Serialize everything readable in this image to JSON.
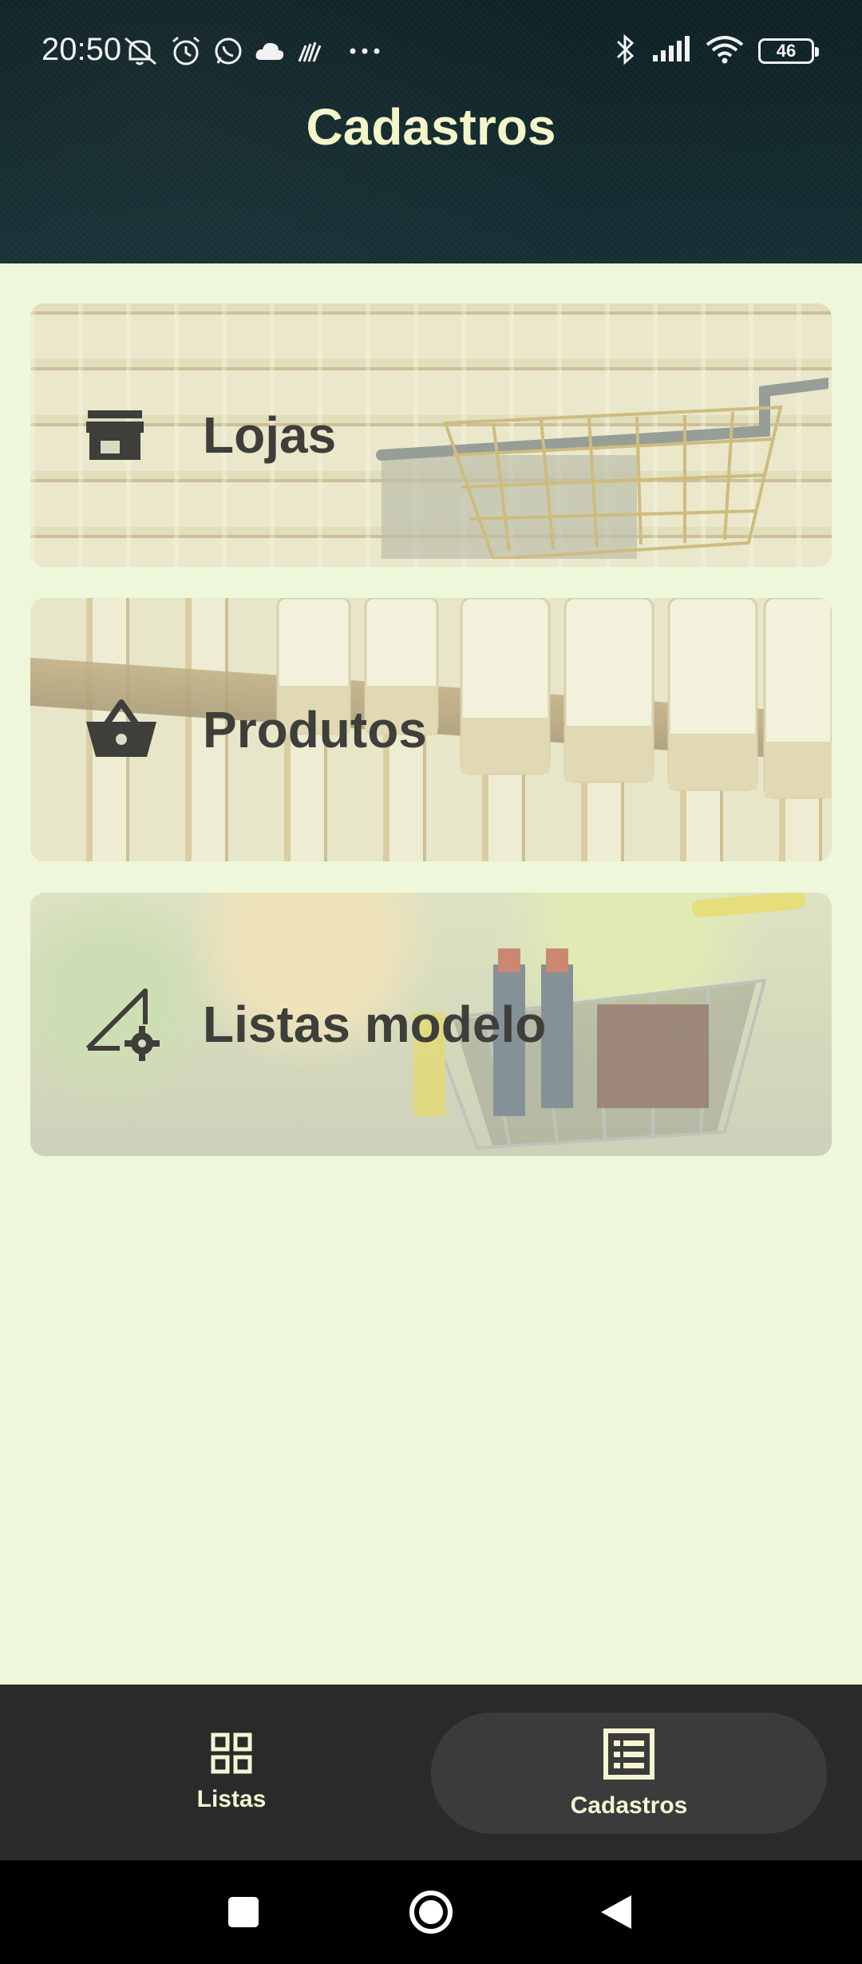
{
  "status_bar": {
    "time": "20:50",
    "battery": "46",
    "left_icons": [
      "mute-icon",
      "alarm-icon",
      "whatsapp-icon",
      "cloud-icon",
      "signal-app-icon",
      "more-dots-icon"
    ],
    "right_icons": [
      "bluetooth-icon",
      "cell-signal-icon",
      "wifi-icon",
      "battery-icon"
    ]
  },
  "header": {
    "title": "Cadastros"
  },
  "cards": [
    {
      "label": "Lojas",
      "icon": "store-icon"
    },
    {
      "label": "Produtos",
      "icon": "basket-icon"
    },
    {
      "label": "Listas modelo",
      "icon": "template-settings-icon"
    }
  ],
  "bottom_nav": {
    "items": [
      {
        "label": "Listas",
        "icon": "grid-icon",
        "selected": false
      },
      {
        "label": "Cadastros",
        "icon": "list-icon",
        "selected": true
      }
    ]
  },
  "colors": {
    "header_bg": "#132a2e",
    "page_bg": "#eef7d9",
    "title": "#f3f6c8",
    "card_text": "#3e3e3a",
    "nav_bg": "#2a2a2a",
    "nav_active_pill": "#3b3b3b"
  }
}
